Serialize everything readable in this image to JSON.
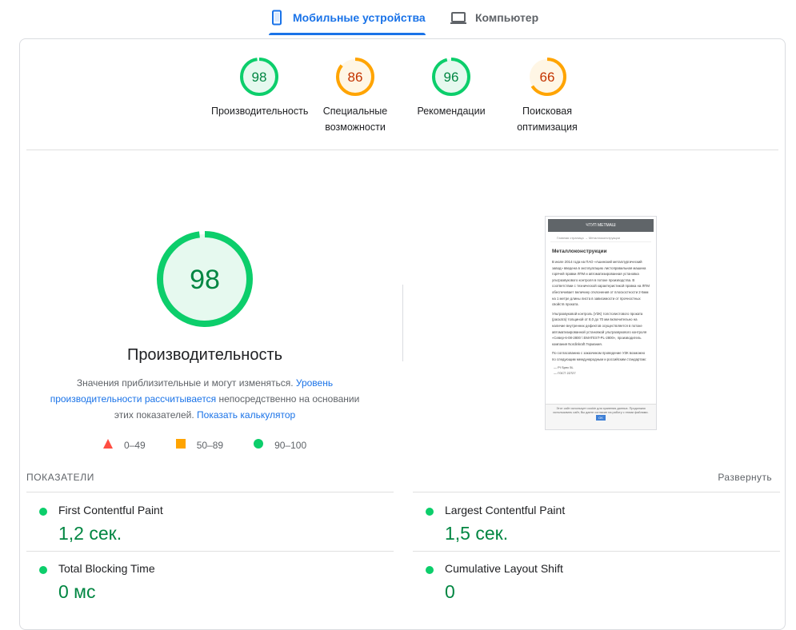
{
  "tabs": {
    "mobile": {
      "label": "Мобильные устройства",
      "icon": "phone-icon"
    },
    "desktop": {
      "label": "Компьютер",
      "icon": "laptop-icon"
    }
  },
  "colors": {
    "pass": "#0cce6b",
    "pass_text": "#018642",
    "average": "#ffa400",
    "average_text": "#c33300",
    "link": "#1a73e8",
    "active_tab": "#1a73e8"
  },
  "scores": [
    {
      "value": "98",
      "score": 98,
      "label_line1": "Производительность",
      "label_line2": "",
      "status": "pass"
    },
    {
      "value": "86",
      "score": 86,
      "label_line1": "Специальные",
      "label_line2": "возможности",
      "status": "average"
    },
    {
      "value": "96",
      "score": 96,
      "label_line1": "Рекомендации",
      "label_line2": "",
      "status": "pass"
    },
    {
      "value": "66",
      "score": 66,
      "label_line1": "Поисковая",
      "label_line2": "оптимизация",
      "status": "average"
    }
  ],
  "performance": {
    "value": "98",
    "score": 98,
    "title": "Производительность",
    "desc_part1": "Значения приблизительные и могут изменяться. ",
    "desc_link1": "Уровень производительности рассчитывается",
    "desc_part2": " непосредственно на основании этих показателей. ",
    "desc_link2": "Показать калькулятор"
  },
  "legend": [
    {
      "range": "0–49",
      "shape": "triangle",
      "color": "#ff4e42"
    },
    {
      "range": "50–89",
      "shape": "square",
      "color": "#ffa400"
    },
    {
      "range": "90–100",
      "shape": "circle",
      "color": "#0cce6b"
    }
  ],
  "screenshot": {
    "site_title": "ЧТУП МЕТМАШ",
    "crumb1": "Главная страница",
    "crumb_sep": "→",
    "crumb2": "Металлоконструкции",
    "heading": "Металлоконструкции",
    "para1": "В июле 2014 года на ПАО «Ашинский металлургический завод» введена в эксплуатацию листоправильная машина горячей правки ЛПМ и автоматизированная установка ультразвукового контроля в потоке производства. В соответствии с технической характеристикой правка на ЛПМ обеспечивает величину отклонения от плоскостности 2-5мм на 1 метре длины листа в зависимости от прочностных свойств проката.",
    "para2": "Ультразвуковой контроль (УЗК) толстолистового проката (раската) толщиной от 8,0 до 70 мм включительно на наличие внутренних дефектов осуществляется в потоке автоматизированной установкой ультразвукового контроля «Север-6-08-2800 \\ EMATEST-PL-2800», производитель компания Nordinkraft Германия.",
    "para3": "По согласованию с заказчиком проведение УЗК возможно по следующим международным и российским стандартам:",
    "list": [
      "PI Spec 5L",
      "ГОСТ 22727"
    ],
    "cookie_text": "Этот сайт использует cookie для хранения данных. Продолжая использовать сайт, Вы даете согласие на работу с этими файлами.",
    "cookie_ok": "OK"
  },
  "metrics_header": "ПОКАЗАТЕЛИ",
  "expand_label": "Развернуть",
  "metrics": [
    {
      "name": "First Contentful Paint",
      "value": "1,2 сек.",
      "status": "pass"
    },
    {
      "name": "Largest Contentful Paint",
      "value": "1,5 сек.",
      "status": "pass"
    },
    {
      "name": "Total Blocking Time",
      "value": "0 мс",
      "status": "pass"
    },
    {
      "name": "Cumulative Layout Shift",
      "value": "0",
      "status": "pass"
    }
  ]
}
